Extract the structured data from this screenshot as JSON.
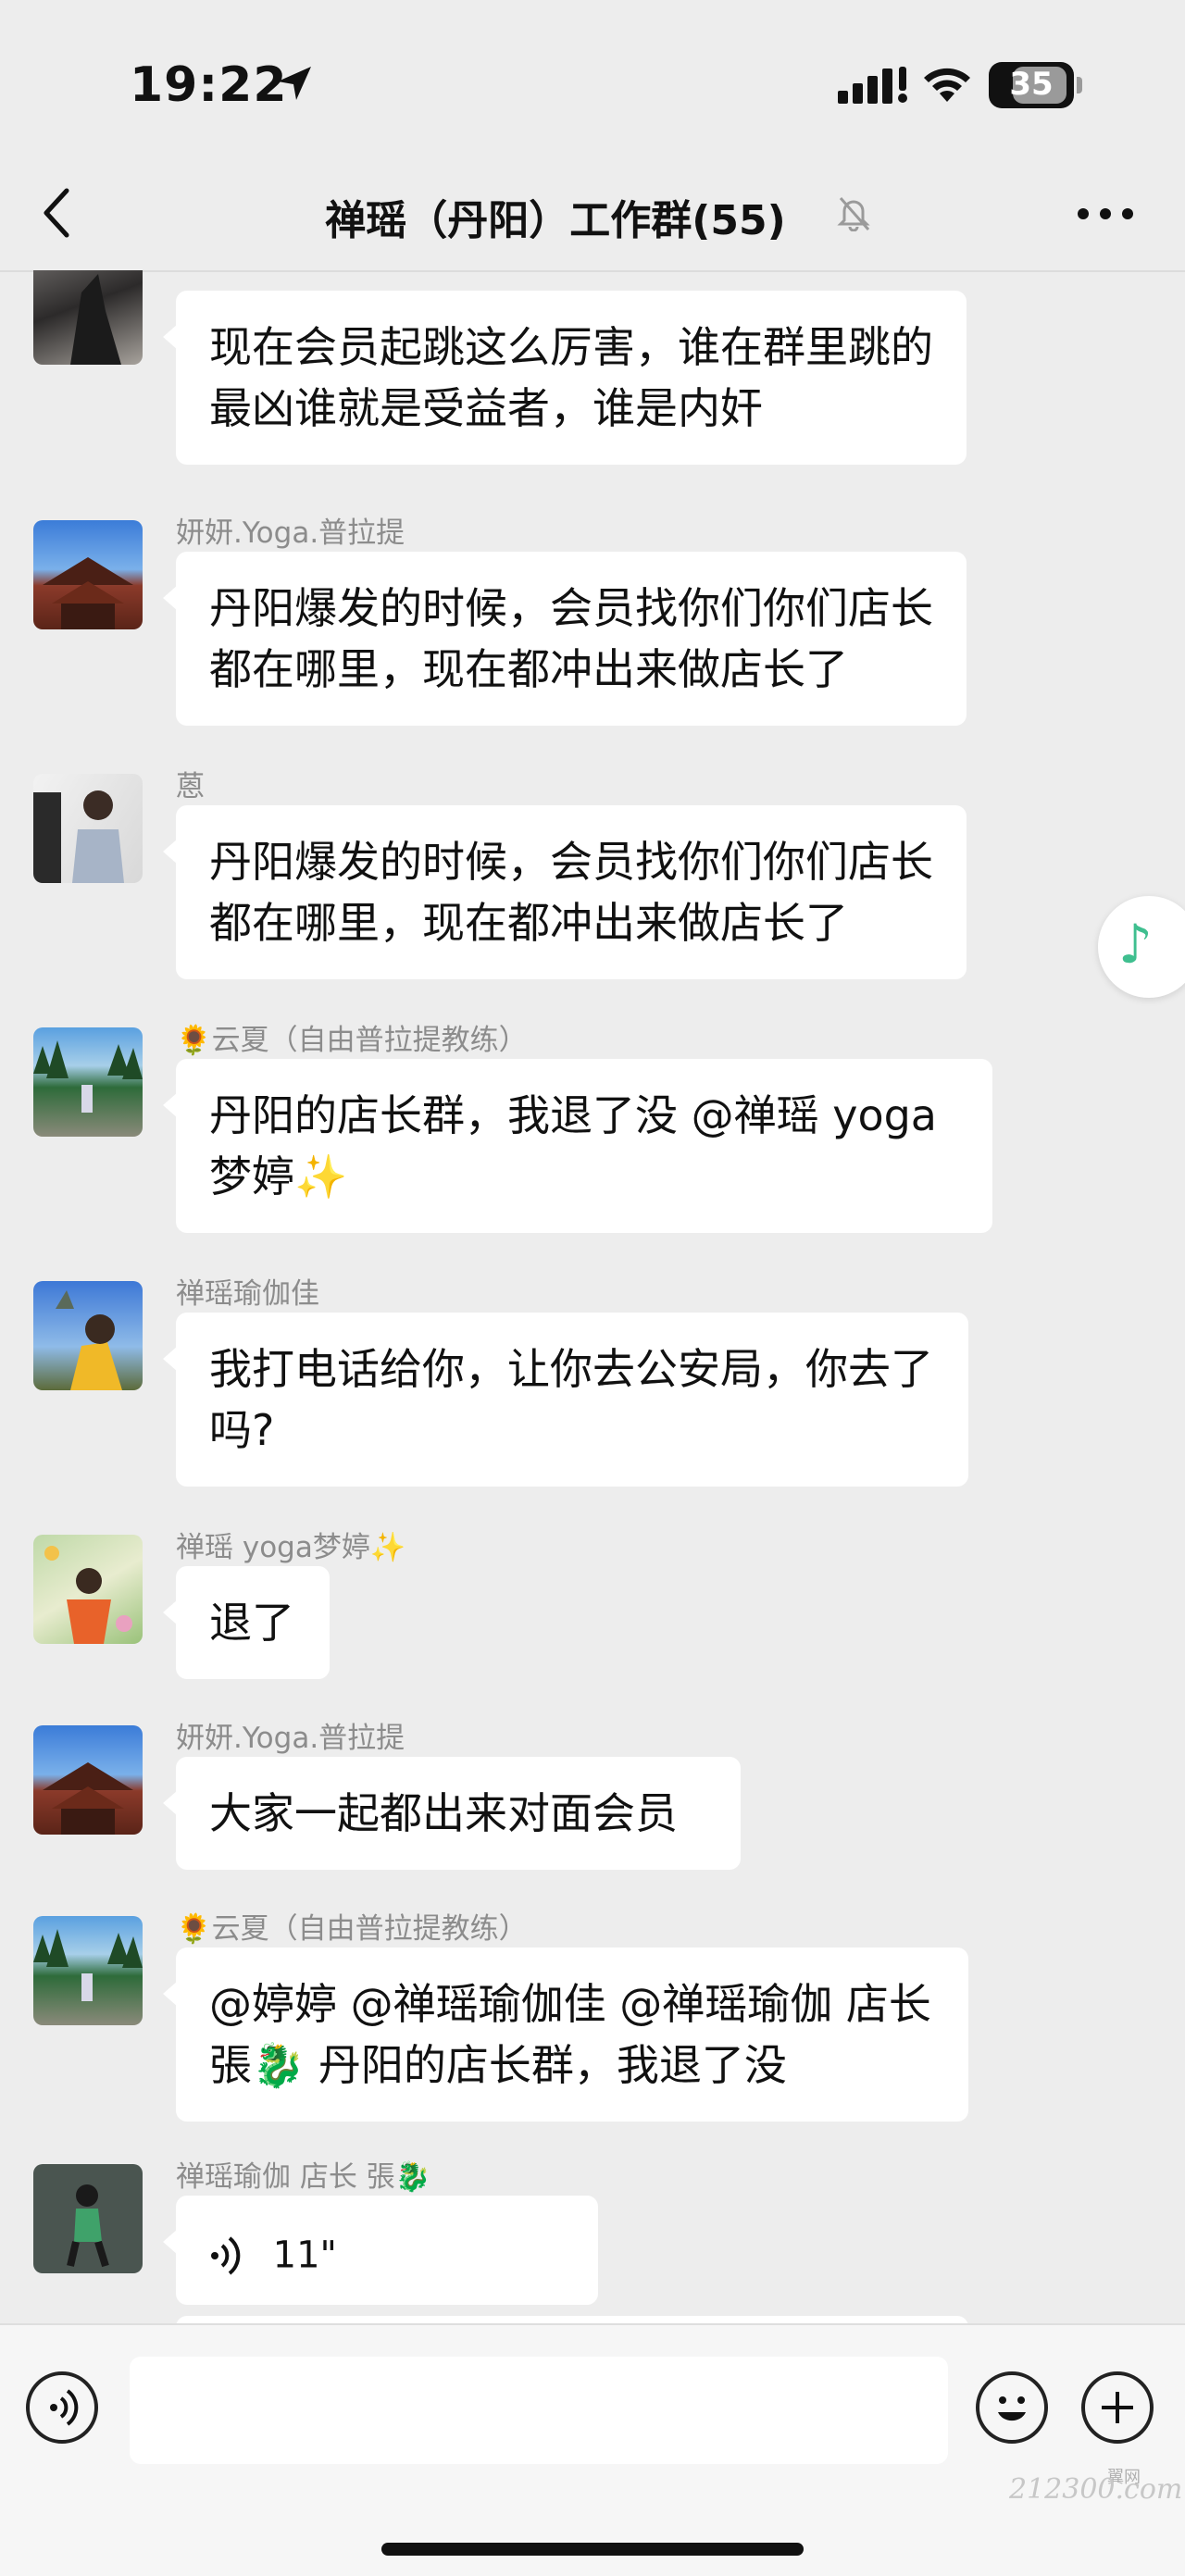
{
  "status_bar": {
    "time": "19:22",
    "battery": "35"
  },
  "header": {
    "back_icon": "chevron-left-icon",
    "title": "禅瑶（丹阳）工作群(55)",
    "mute_icon": "bell-off-icon",
    "more_icon": "ellipsis-icon"
  },
  "messages": [
    {
      "sender": "",
      "text": "现在会员起跳这么厉害，谁在群里跳的最凶谁就是受益者，谁是内奸"
    },
    {
      "sender": "妍妍.Yoga.普拉提",
      "text": "丹阳爆发的时候，会员找你们你们店长都在哪里，现在都冲出来做店长了"
    },
    {
      "sender": "蒽",
      "text": "丹阳爆发的时候，会员找你们你们店长都在哪里，现在都冲出来做店长了"
    },
    {
      "sender": "🌻云夏（自由普拉提教练）",
      "text": "丹阳的店长群，我退了没 @禅瑶 yoga梦婷✨"
    },
    {
      "sender": "禅瑶瑜伽佳",
      "text": "我打电话给你，让你去公安局，你去了吗?"
    },
    {
      "sender": "禅瑶 yoga梦婷✨",
      "text": "退了"
    },
    {
      "sender": "妍妍.Yoga.普拉提",
      "text": "大家一起都出来对面会员"
    },
    {
      "sender": "🌻云夏（自由普拉提教练）",
      "text": "@婷婷 @禅瑶瑜伽佳 @禅瑶瑜伽 店长 張🐉 丹阳的店长群，我退了没"
    },
    {
      "sender": "禅瑶瑜伽 店长 張🐉",
      "voice_duration": "11\""
    }
  ],
  "floating": {
    "music_icon": "music-note-icon"
  },
  "input_bar": {
    "voice_icon": "voice-input-icon",
    "emoji_icon": "emoji-icon",
    "plus_icon": "plus-icon",
    "placeholder": ""
  },
  "watermark": {
    "text": "212300.com",
    "sub": "翼网"
  },
  "colors": {
    "background": "#ededed",
    "bubble": "#ffffff",
    "music_accent": "#3fbf8f"
  }
}
